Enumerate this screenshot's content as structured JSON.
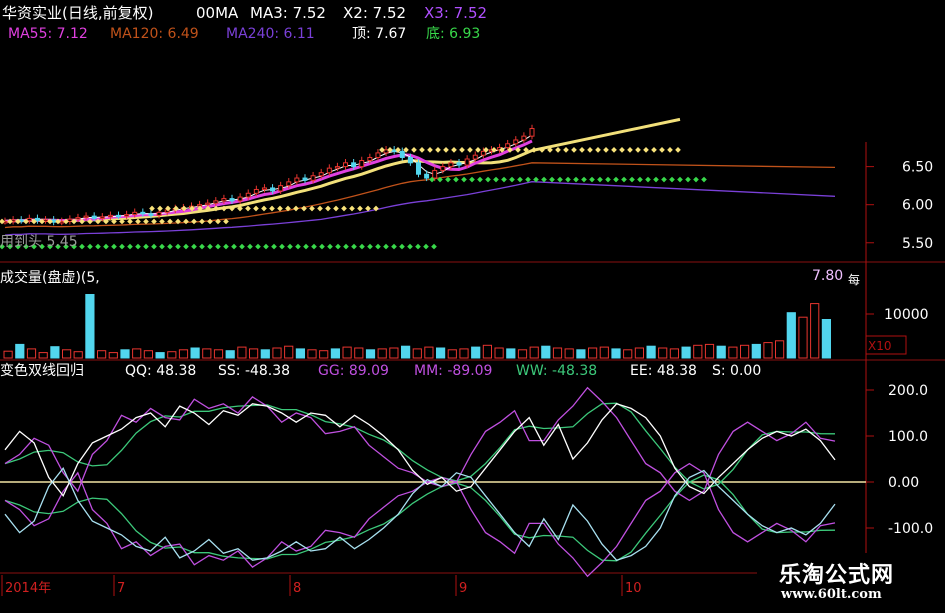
{
  "header": {
    "stock": "华资实业(日线,前复权)",
    "ma_label": "00MA",
    "ma3": "MA3: 7.52",
    "x2": "X2: 7.52",
    "x3": "X3: 7.52",
    "ma55": "MA55: 7.12",
    "ma120": "MA120: 6.49",
    "ma240": "MA240: 6.11",
    "top": "顶: 7.67",
    "bottom": "底: 6.93",
    "price_note": "用到头 5.45"
  },
  "volume_header": {
    "title": "成交量(盘虚)(5,",
    "peak": "7.80",
    "side": "每",
    "unit": "X10"
  },
  "indicator_header": {
    "title": "变色双线回归",
    "qq": "QQ: 48.38",
    "ss": "SS: -48.38",
    "gg": "GG: 89.09",
    "mm": "MM: -89.09",
    "ww": "WW: -48.38",
    "ee": "EE: 48.38",
    "s": "S: 0.00"
  },
  "watermark": {
    "title": "乐淘公式网",
    "url": "www.60lt.com"
  },
  "colors": {
    "up": "#e8352f",
    "down": "#52d6ee",
    "ma_white": "#ffffff",
    "ma_yellow": "#f2e07a",
    "ma_magenta": "#e040e0",
    "ma_orange": "#c0521a",
    "ma_purple": "#7a40d8",
    "dot_yellow": "#f8e27a",
    "dot_green": "#38d84a",
    "axis": "#b01010",
    "qq": "#ffffff",
    "gg": "#c050e0",
    "green_line": "#3cc87a"
  },
  "chart_data": [
    {
      "type": "line",
      "title": "华资实业(日线,前复权)",
      "ylim": [
        5.3,
        7.9
      ],
      "yticks": [
        "6.50",
        "6.00",
        "5.50"
      ],
      "series": [
        {
          "name": "MA3",
          "last": 7.52
        },
        {
          "name": "X2",
          "last": 7.52
        },
        {
          "name": "X3",
          "last": 7.52
        },
        {
          "name": "MA55",
          "last": 7.12
        },
        {
          "name": "MA120",
          "last": 6.49
        },
        {
          "name": "MA240",
          "last": 6.11
        }
      ],
      "close": [
        5.78,
        5.8,
        5.79,
        5.82,
        5.79,
        5.8,
        5.77,
        5.78,
        5.81,
        5.83,
        5.85,
        5.82,
        5.84,
        5.86,
        5.85,
        5.87,
        5.9,
        5.88,
        5.86,
        5.9,
        5.93,
        5.95,
        5.96,
        5.98,
        6.0,
        6.02,
        6.05,
        6.08,
        6.05,
        6.1,
        6.15,
        6.2,
        6.22,
        6.18,
        6.25,
        6.3,
        6.35,
        6.32,
        6.38,
        6.42,
        6.48,
        6.5,
        6.55,
        6.5,
        6.58,
        6.62,
        6.68,
        6.72,
        6.7,
        6.62,
        6.55,
        6.4,
        6.35,
        6.45,
        6.5,
        6.55,
        6.52,
        6.6,
        6.65,
        6.7,
        6.72,
        6.75,
        6.8,
        6.85,
        6.9,
        7.0
      ],
      "top": 7.67,
      "bottom": 6.93,
      "dotted_levels": [
        {
          "color": "yellow",
          "value": 5.78
        },
        {
          "color": "yellow",
          "value": 5.95
        },
        {
          "color": "yellow",
          "value": 6.72
        },
        {
          "color": "green",
          "value": 5.45
        },
        {
          "color": "green",
          "value": 6.33
        }
      ]
    },
    {
      "type": "bar",
      "title": "成交量(盘虚)(5,",
      "yticks": [
        "10000"
      ],
      "unit": "X10",
      "values": [
        15,
        30,
        20,
        12,
        25,
        18,
        14,
        140,
        16,
        12,
        18,
        20,
        16,
        12,
        14,
        18,
        22,
        20,
        18,
        16,
        24,
        20,
        18,
        22,
        26,
        20,
        18,
        16,
        20,
        24,
        22,
        18,
        20,
        22,
        26,
        20,
        24,
        22,
        18,
        20,
        24,
        28,
        22,
        20,
        18,
        24,
        26,
        22,
        20,
        18,
        22,
        24,
        20,
        18,
        22,
        26,
        22,
        20,
        24,
        28,
        30,
        26,
        24,
        28,
        30,
        34,
        38,
        100,
        90,
        120,
        85
      ]
    },
    {
      "type": "line",
      "title": "变色双线回归",
      "yticks": [
        "200.0",
        "100.0",
        "0.00",
        "-100.0"
      ],
      "ylim": [
        -210,
        220
      ],
      "x_labels": [
        "2014年",
        "7",
        "8",
        "9",
        "10"
      ],
      "series": [
        {
          "name": "QQ",
          "last": 48.38,
          "values": [
            70,
            110,
            85,
            10,
            -30,
            40,
            85,
            100,
            115,
            140,
            150,
            120,
            165,
            150,
            125,
            155,
            145,
            170,
            165,
            150,
            130,
            150,
            145,
            120,
            145,
            125,
            100,
            70,
            25,
            -5,
            10,
            -20,
            -10,
            30,
            70,
            110,
            140,
            80,
            125,
            50,
            85,
            135,
            170,
            160,
            140,
            100,
            30,
            -10,
            -25,
            10,
            40,
            70,
            95,
            110,
            100,
            115,
            90,
            48
          ]
        },
        {
          "name": "SS",
          "last": -48.38
        },
        {
          "name": "GG",
          "last": 89.09,
          "values": [
            40,
            60,
            95,
            80,
            20,
            -20,
            60,
            90,
            145,
            130,
            160,
            140,
            135,
            180,
            160,
            170,
            150,
            185,
            165,
            130,
            150,
            140,
            105,
            110,
            120,
            80,
            55,
            30,
            20,
            0,
            -10,
            0,
            60,
            110,
            130,
            155,
            90,
            90,
            135,
            165,
            205,
            175,
            140,
            90,
            40,
            20,
            -20,
            -40,
            -20,
            60,
            110,
            130,
            110,
            90,
            105,
            130,
            95,
            89
          ]
        },
        {
          "name": "MM",
          "last": -89.09
        },
        {
          "name": "WW",
          "last": -48.38
        },
        {
          "name": "EE",
          "last": 48.38
        },
        {
          "name": "S",
          "last": 0.0
        }
      ]
    }
  ]
}
